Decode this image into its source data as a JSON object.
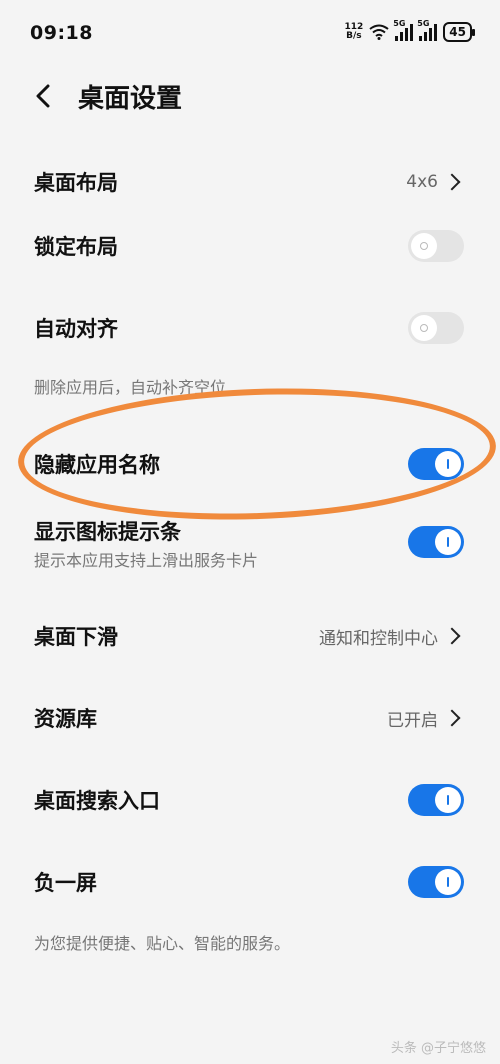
{
  "status": {
    "time": "09:18",
    "speed_top": "112",
    "speed_bottom": "B/s",
    "net1": "5G",
    "net2": "5G",
    "battery": "45"
  },
  "header": {
    "title": "桌面设置"
  },
  "rows": {
    "layout": {
      "label": "桌面布局",
      "value": "4x6"
    },
    "lock_layout": {
      "label": "锁定布局",
      "on": false
    },
    "auto_align": {
      "label": "自动对齐",
      "on": false,
      "desc": "删除应用后，自动补齐空位"
    },
    "hide_names": {
      "label": "隐藏应用名称",
      "on": true
    },
    "show_bar": {
      "label": "显示图标提示条",
      "on": true,
      "desc": "提示本应用支持上滑出服务卡片"
    },
    "swipe_down": {
      "label": "桌面下滑",
      "value": "通知和控制中心"
    },
    "library": {
      "label": "资源库",
      "value": "已开启"
    },
    "search": {
      "label": "桌面搜索入口",
      "on": true
    },
    "minus_one": {
      "label": "负一屏",
      "on": true,
      "desc": "为您提供便捷、贴心、智能的服务。"
    }
  },
  "watermark": "头条 @子宁悠悠",
  "colors": {
    "toggle_on": "#1876e8",
    "toggle_off": "#e4e4e4",
    "annotation": "#f08a3c",
    "background": "#f4f4f4"
  }
}
